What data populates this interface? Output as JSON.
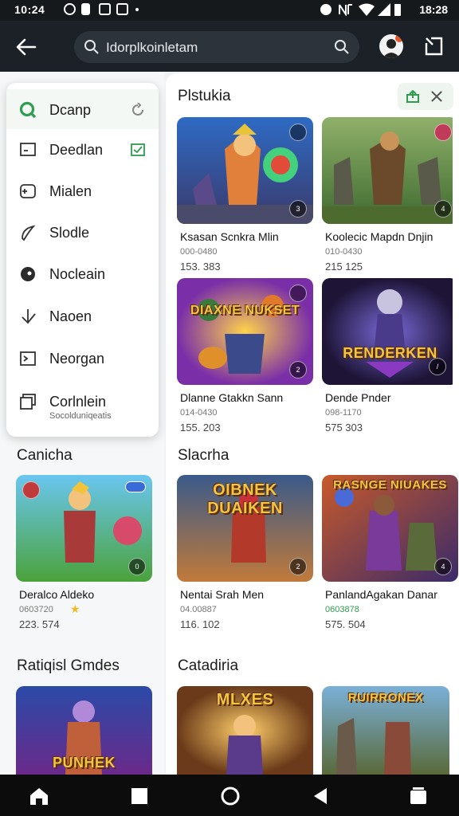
{
  "status": {
    "time_left": "10:24",
    "time_right": "18:28"
  },
  "appbar": {
    "search_text": "Idorplkoinletam"
  },
  "drawer": {
    "items": [
      {
        "label": "Dcanp",
        "sub": ""
      },
      {
        "label": "Deedlan",
        "sub": ""
      },
      {
        "label": "Mialen",
        "sub": ""
      },
      {
        "label": "Slodle",
        "sub": ""
      },
      {
        "label": "Nocleain",
        "sub": ""
      },
      {
        "label": "Naoen",
        "sub": ""
      },
      {
        "label": "Neorgan",
        "sub": ""
      },
      {
        "label": "Corlnlein",
        "sub": "Socolduniqeatis"
      }
    ]
  },
  "sections": {
    "left_mid": "Canicha",
    "left_bottom": "Ratiqisl Gmdes",
    "right_top": "Plstukia",
    "right_mid": "Slacrha",
    "right_bottom": "Catadiria"
  },
  "cards": [
    {
      "name": "Ksasan Scnkra Mlin",
      "l2": "000-0480",
      "l3": "153. 383",
      "title": ""
    },
    {
      "name": "Koolecic Mapdn Dnjin",
      "l2": "010-0430",
      "l3": "215 125",
      "title": ""
    },
    {
      "name": "Dlanne Gtakkn Sann",
      "l2": "014-0430",
      "l3": "155. 203",
      "title": "DIAXNE NUKSET"
    },
    {
      "name": "Dende Pnder",
      "l2": "098-1170",
      "l3": "575 303",
      "title": "RENDERKEN"
    },
    {
      "name": "Deralco Aldeko",
      "l2": "0603720",
      "l3": "223. 574",
      "title": ""
    },
    {
      "name": "Nentai Srah Men",
      "l2": "04.00887",
      "l3": "116. 102",
      "title": "OIBNEK DUAIKEN"
    },
    {
      "name": "PanlandAgakan Danar",
      "l2": "0603878",
      "l3": "575. 504",
      "title": "RASNGE NIUAKES"
    },
    {
      "name": "",
      "l2": "",
      "l3": "",
      "title": "PUNHEK"
    },
    {
      "name": "",
      "l2": "",
      "l3": "",
      "title": "MLXES"
    },
    {
      "name": "",
      "l2": "",
      "l3": "",
      "title": "RUIRRONEX"
    }
  ],
  "colors": {
    "accent": "#2e9d4f",
    "appbar": "#1c2128",
    "navbar": "#0c0c0c"
  },
  "icons": [
    "back-arrow-icon",
    "search-icon",
    "avatar",
    "exit-icon",
    "home-icon",
    "square-icon",
    "circle-icon",
    "back-triangle-icon",
    "recents-icon"
  ]
}
